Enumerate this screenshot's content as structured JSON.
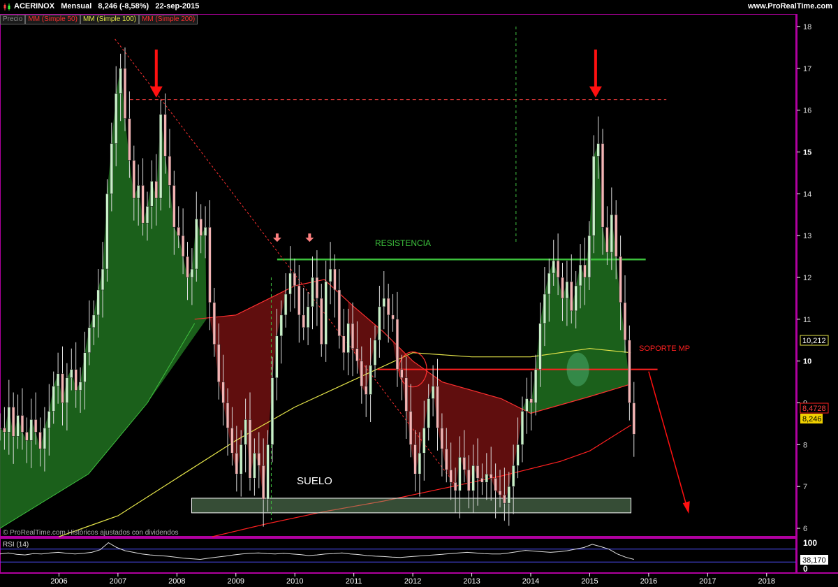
{
  "header": {
    "symbol": "ACERINOX",
    "period": "Mensual",
    "last": "8,246 (-8,58%)",
    "date": "22-sep-2015",
    "site": "www.ProRealTime.com"
  },
  "legend": {
    "price": "Precio",
    "ma50": "MM (Simple 50)",
    "ma100": "MM (Simple 100)",
    "ma200": "MM (Simple 200)"
  },
  "colors": {
    "ma50": "#ff3030",
    "ma100": "#e6e64a",
    "ma200": "#ff2020",
    "green_fill": "#1e6a1e",
    "red_fill": "#6a1010",
    "bull": "#c8f0c8",
    "bear": "#f4b4b4",
    "resistance": "#3cc03c",
    "support": "#ff2020",
    "frame": "#b0009f"
  },
  "annotations": {
    "resistencia": "RESISTENCIA",
    "suelo": "SUELO",
    "soporte": "SOPORTE MP"
  },
  "badges": {
    "ma100_value": "10,212",
    "ma200_value": "8,4728",
    "price_value": "8,246",
    "rsi_value": "38,170"
  },
  "footer_note": "© ProRealTime.com  Históricos ajustados con dividendos",
  "rsi": {
    "label": "RSI (14)",
    "ticks": [
      "100",
      "0"
    ],
    "ylim": [
      0,
      100
    ]
  },
  "chart_data": {
    "type": "candlestick",
    "xlabel": "",
    "ylabel": "",
    "ylim": [
      5.8,
      18.3
    ],
    "xlim": [
      2005.0,
      2018.5
    ],
    "x_ticks": [
      "2006",
      "2007",
      "2008",
      "2009",
      "2010",
      "2011",
      "2012",
      "2013",
      "2014",
      "2015",
      "2016",
      "2017",
      "2018"
    ],
    "y_ticks": [
      "6",
      "7",
      "8",
      "9",
      "10",
      "11",
      "12",
      "13",
      "14",
      "15",
      "16",
      "17",
      "18"
    ],
    "resistance_level": 12.43,
    "support_level": 9.8,
    "top_level": 16.25,
    "floor_band": [
      6.37,
      6.72
    ],
    "closes": [
      8.4,
      8.3,
      8.9,
      8.2,
      8.7,
      8.3,
      8.1,
      8.6,
      8.3,
      7.9,
      8.4,
      8.8,
      9.4,
      9.7,
      9.0,
      9.6,
      9.8,
      9.3,
      9.5,
      10.2,
      10.8,
      11.1,
      11.7,
      12.2,
      14.0,
      15.2,
      16.4,
      17.0,
      15.8,
      14.8,
      13.9,
      14.2,
      13.3,
      13.7,
      14.3,
      13.9,
      15.9,
      14.9,
      14.2,
      13.2,
      13.0,
      12.5,
      12.0,
      12.2,
      13.4,
      13.0,
      13.2,
      11.4,
      10.4,
      9.5,
      9.0,
      8.4,
      7.8,
      7.3,
      8.0,
      8.6,
      7.2,
      7.8,
      7.5,
      6.7,
      8.0,
      9.6,
      10.6,
      11.1,
      11.6,
      12.1,
      11.8,
      11.1,
      10.8,
      11.3,
      12.0,
      11.5,
      10.4,
      11.9,
      12.2,
      11.7,
      10.6,
      10.2,
      10.9,
      10.3,
      10.0,
      9.4,
      9.2,
      9.9,
      10.5,
      11.3,
      11.5,
      11.1,
      11.0,
      9.8,
      9.6,
      8.8,
      8.0,
      7.3,
      7.8,
      8.4,
      9.1,
      9.4,
      8.4,
      7.9,
      7.4,
      7.1,
      6.9,
      7.7,
      7.4,
      6.9,
      7.5,
      7.2,
      7.1,
      7.3,
      7.2,
      6.9,
      6.8,
      6.6,
      7.0,
      7.5,
      8.0,
      8.8,
      9.1,
      9.0,
      9.8,
      10.9,
      11.6,
      12.1,
      12.4,
      12.0,
      11.5,
      11.9,
      11.2,
      11.8,
      12.3,
      12.0,
      13.0,
      14.9,
      15.2,
      13.2,
      12.6,
      13.5,
      12.5,
      11.4,
      10.5,
      9.0,
      8.25
    ],
    "series": [
      {
        "name": "MM (Simple 50)",
        "x": [
          2008.3,
          2009.0,
          2010.0,
          2010.5,
          2011.0,
          2011.5,
          2012.0,
          2012.5,
          2013.0,
          2013.5,
          2014.0,
          2014.5,
          2015.0,
          2015.7
        ],
        "values": [
          11.0,
          11.1,
          11.8,
          11.95,
          11.3,
          10.7,
          10.0,
          9.5,
          9.3,
          9.1,
          8.75,
          8.95,
          9.15,
          9.45
        ]
      },
      {
        "name": "MM (Simple 100)",
        "x": [
          2006.0,
          2007.0,
          2008.0,
          2009.0,
          2010.0,
          2011.0,
          2012.0,
          2013.0,
          2014.0,
          2015.0,
          2015.7
        ],
        "values": [
          5.8,
          6.3,
          7.2,
          8.1,
          8.9,
          9.55,
          10.2,
          10.1,
          10.1,
          10.3,
          10.2
        ]
      },
      {
        "name": "MM (Simple 200)",
        "x": [
          2008.6,
          2009.5,
          2010.5,
          2011.5,
          2012.5,
          2013.5,
          2014.5,
          2015.0,
          2015.7
        ],
        "values": [
          5.8,
          6.1,
          6.4,
          6.65,
          6.95,
          7.25,
          7.6,
          7.85,
          8.47
        ]
      }
    ],
    "rsi_values": [
      55,
      58,
      54,
      52,
      56,
      55,
      58,
      60,
      57,
      55,
      57,
      60,
      68,
      90,
      75,
      65,
      60,
      55,
      52,
      50,
      48,
      45,
      42,
      40,
      38,
      42,
      45,
      48,
      52,
      55,
      57,
      58,
      56,
      55,
      57,
      55,
      53,
      50,
      52,
      55,
      56,
      58,
      55,
      53,
      50,
      48,
      47,
      45,
      44,
      46,
      48,
      50,
      52,
      54,
      56,
      58,
      60,
      58,
      56,
      55,
      55,
      58,
      62,
      66,
      64,
      62,
      60,
      62,
      65,
      70,
      75,
      85,
      78,
      70,
      55,
      45,
      38
    ]
  }
}
